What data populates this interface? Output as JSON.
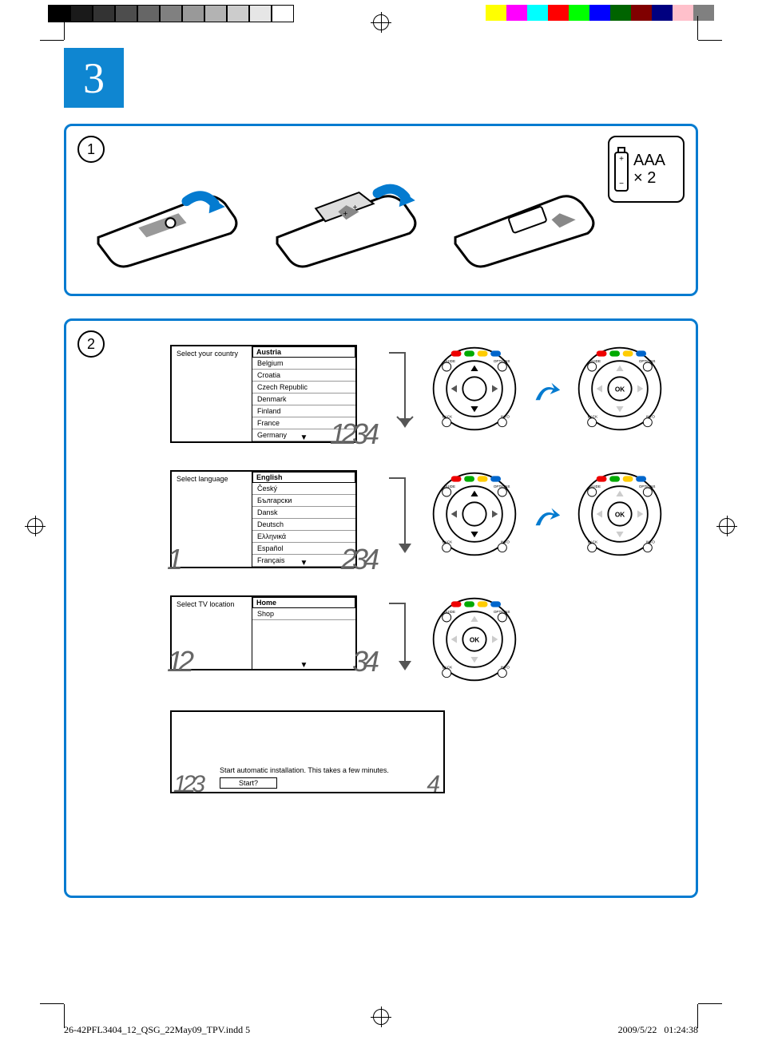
{
  "step_number": "3",
  "panel1": {
    "label": "1",
    "battery_text_line1": "AAA",
    "battery_text_line2": "× 2"
  },
  "panel2": {
    "label": "2",
    "country": {
      "prompt": "Select your country",
      "selected": "Austria",
      "options": [
        "Belgium",
        "Croatia",
        "Czech Republic",
        "Denmark",
        "Finland",
        "France",
        "Germany"
      ],
      "nums_right": "1234"
    },
    "language": {
      "prompt": "Select language",
      "selected": "English",
      "options": [
        "Český",
        "Български",
        "Dansk",
        "Deutsch",
        "Ελληνικά",
        "Español",
        "Français"
      ],
      "nums_left": "1",
      "nums_right": "234"
    },
    "location": {
      "prompt": "Select TV location",
      "selected": "Home",
      "options": [
        "Shop"
      ],
      "nums_left": "12",
      "nums_right": "34"
    },
    "install": {
      "message": "Start automatic installation. This takes a few minutes.",
      "button": "Start?",
      "nums_left": "123",
      "nums_right": "4"
    },
    "dpad_labels": {
      "guide": "GUIDE",
      "options": "OPTIONS",
      "back": "BACK",
      "info": "INFO",
      "ok": "OK"
    }
  },
  "footer": {
    "filename": "26-42PFL3404_12_QSG_22May09_TPV.indd   5",
    "date": "2009/5/22",
    "time": "01:24:38"
  },
  "color_bar": {
    "grays": [
      "#000",
      "#1a1a1a",
      "#333",
      "#4d4d4d",
      "#666",
      "#808080",
      "#999",
      "#b3b3b3",
      "#ccc",
      "#e6e6e6",
      "#fff"
    ],
    "colors": [
      "#ffff00",
      "#ff00ff",
      "#00ffff",
      "#ff0000",
      "#00ff00",
      "#0000ff",
      "#006400",
      "#800000",
      "#000080",
      "#ffc0cb",
      "#808080"
    ]
  }
}
